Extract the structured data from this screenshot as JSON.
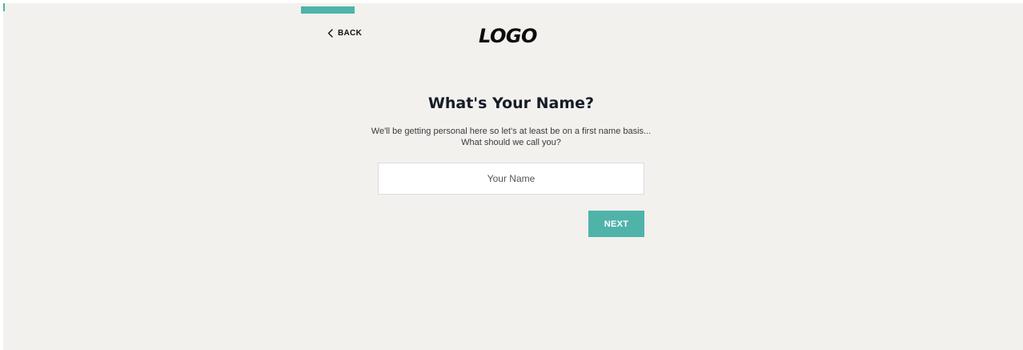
{
  "colors": {
    "accent": "#4fb3a9",
    "background": "#f2f1ee",
    "heading": "#161c26"
  },
  "progress": {
    "fraction": 0.125
  },
  "nav": {
    "back_label": "BACK",
    "back_icon": "chevron-left-icon"
  },
  "logo": {
    "text": "LOGO"
  },
  "main": {
    "title": "What's Your Name?",
    "subtitle_line1": "We'll be getting personal here so let's at least be on a first name basis...",
    "subtitle_line2": "What should we call you?"
  },
  "form": {
    "name_placeholder": "Your Name",
    "name_value": "",
    "next_label": "NEXT"
  }
}
